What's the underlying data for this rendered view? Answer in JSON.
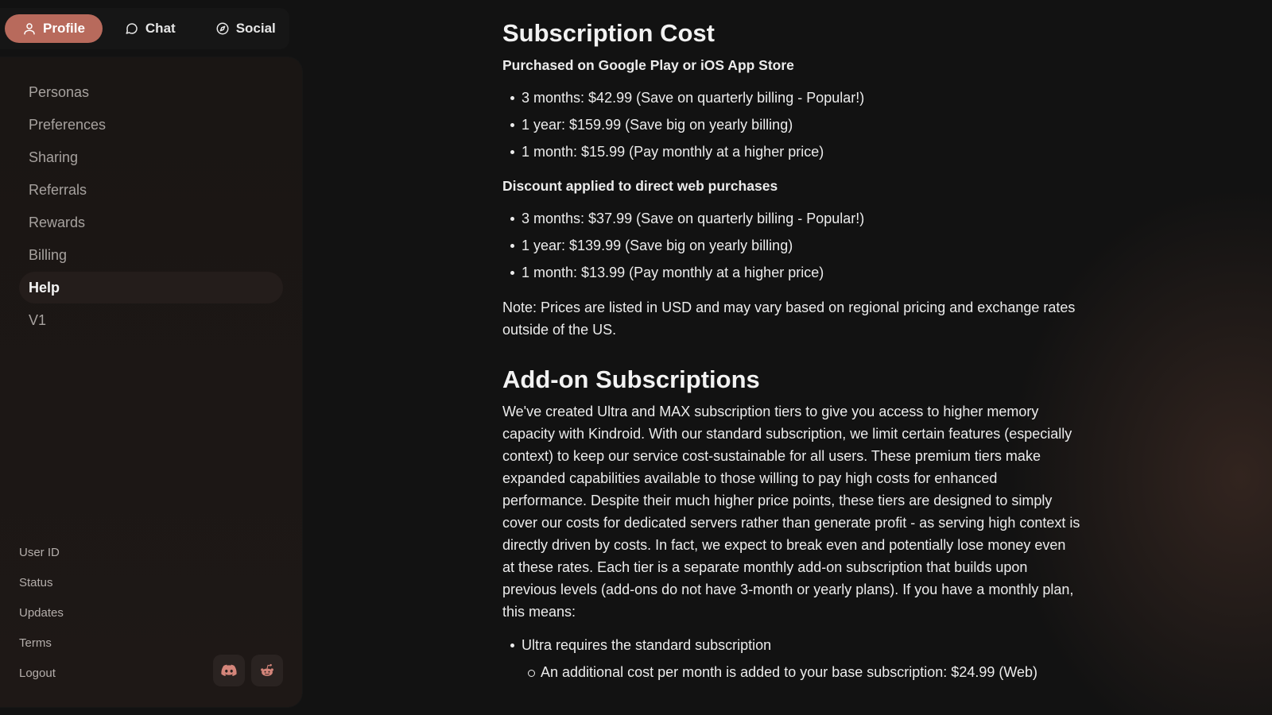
{
  "nav": {
    "tabs": [
      {
        "label": "Profile",
        "icon": "user-icon",
        "active": true
      },
      {
        "label": "Chat",
        "icon": "chat-bubble-icon",
        "active": false
      },
      {
        "label": "Social",
        "icon": "compass-icon",
        "active": false
      }
    ]
  },
  "sidebar": {
    "items": [
      {
        "label": "Personas"
      },
      {
        "label": "Preferences"
      },
      {
        "label": "Sharing"
      },
      {
        "label": "Referrals"
      },
      {
        "label": "Rewards"
      },
      {
        "label": "Billing"
      },
      {
        "label": "Help",
        "active": true
      },
      {
        "label": "V1"
      }
    ],
    "bottom_links": [
      {
        "label": "User ID"
      },
      {
        "label": "Status"
      },
      {
        "label": "Updates"
      },
      {
        "label": "Terms"
      },
      {
        "label": "Logout"
      }
    ],
    "social": [
      {
        "icon": "discord-icon"
      },
      {
        "icon": "reddit-icon"
      }
    ]
  },
  "colors": {
    "accent": "#b86a5c",
    "background": "#121212",
    "icon_accent": "#d4857a"
  },
  "content": {
    "section1_title": "Subscription Cost",
    "store_heading": "Purchased on Google Play or iOS App Store",
    "store_prices": [
      "3 months: $42.99 (Save on quarterly billing - Popular!)",
      "1 year: $159.99 (Save big on yearly billing)",
      "1 month: $15.99 (Pay monthly at a higher price)"
    ],
    "web_heading": "Discount applied to direct web purchases",
    "web_prices": [
      "3 months: $37.99 (Save on quarterly billing - Popular!)",
      "1 year: $139.99 (Save big on yearly billing)",
      "1 month: $13.99 (Pay monthly at a higher price)"
    ],
    "note": "Note: Prices are listed in USD and may vary based on regional pricing and exchange rates outside of the US.",
    "section2_title": "Add-on Subscriptions",
    "addon_paragraph": "We've created Ultra and MAX subscription tiers to give you access to higher memory capacity with Kindroid. With our standard subscription, we limit certain features (especially context) to keep our service cost-sustainable for all users. These premium tiers make expanded capabilities available to those willing to pay high costs for enhanced performance. Despite their much higher price points, these tiers are designed to simply cover our costs for dedicated servers rather than generate profit - as serving high context is directly driven by costs. In fact, we expect to break even and potentially lose money even at these rates. Each tier is a separate monthly add-on subscription that builds upon previous levels (add-ons do not have 3-month or yearly plans). If you have a monthly plan, this means:",
    "ultra_item": "Ultra requires the standard subscription",
    "ultra_sub": "An additional cost per month is added to your base subscription: $24.99 (Web)"
  }
}
